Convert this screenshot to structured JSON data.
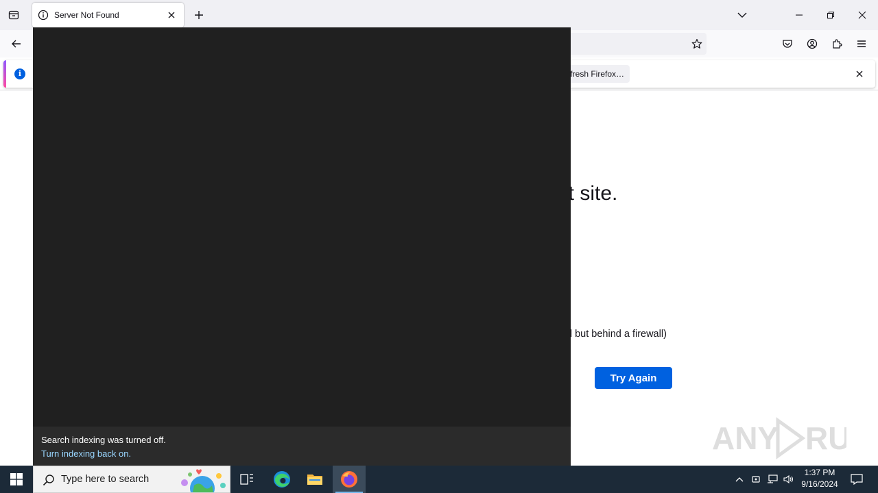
{
  "browser": {
    "tab": {
      "title": "Server Not Found"
    },
    "notification": {
      "refresh_button_label": "Refresh Firefox…"
    }
  },
  "page": {
    "heading_fragment": "nt site.",
    "firewall_fragment": "d but behind a firewall)",
    "try_again_label": "Try Again"
  },
  "search_flyout": {
    "message": "Search indexing was turned off.",
    "link": "Turn indexing back on."
  },
  "taskbar": {
    "search_placeholder": "Type here to search",
    "clock": {
      "time": "1:37 PM",
      "date": "9/16/2024"
    }
  },
  "watermark": {
    "text": "ANY RUN"
  },
  "colors": {
    "accent_blue": "#0061e0",
    "flyout_bg": "#202020",
    "flyout_link": "#99d6ff",
    "taskbar_bg": "#1c2a38"
  }
}
